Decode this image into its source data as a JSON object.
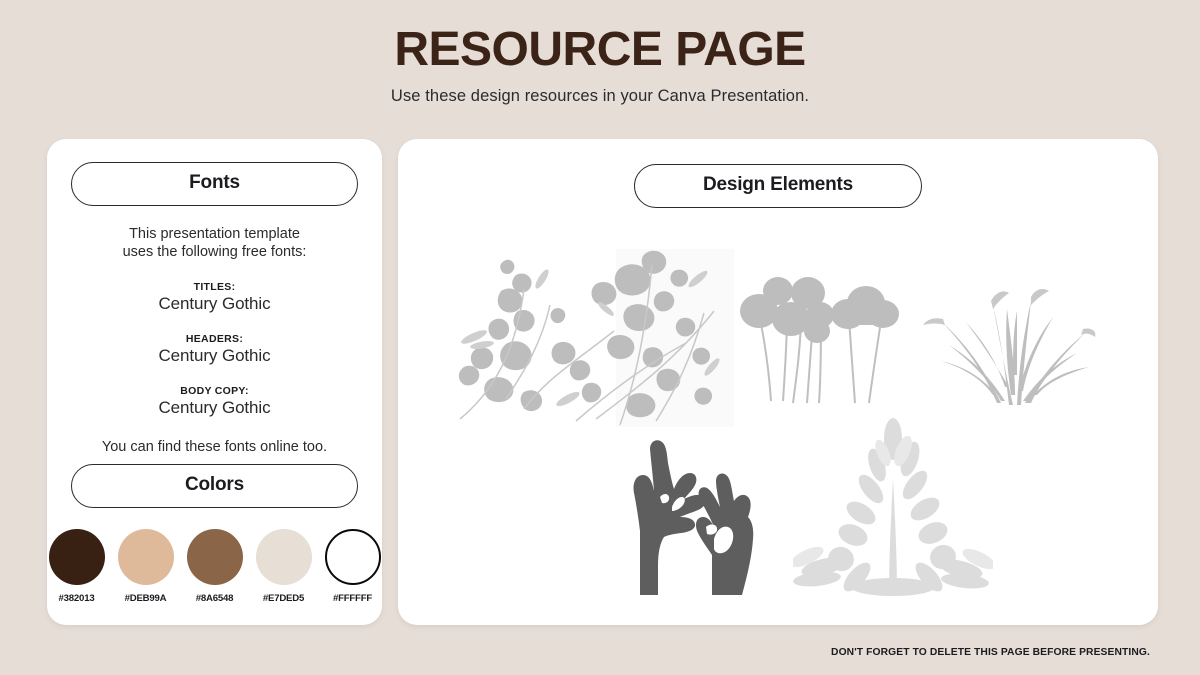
{
  "header": {
    "title": "RESOURCE PAGE",
    "subtitle": "Use these design resources in your Canva Presentation."
  },
  "fonts_panel": {
    "heading": "Fonts",
    "intro_line_1": "This presentation template",
    "intro_line_2": "uses the following free fonts:",
    "groups": [
      {
        "role": "TITLES:",
        "font": "Century Gothic"
      },
      {
        "role": "HEADERS:",
        "font": "Century Gothic"
      },
      {
        "role": "BODY COPY:",
        "font": "Century Gothic"
      }
    ],
    "outro": "You can find these fonts online too."
  },
  "colors_panel": {
    "heading": "Colors",
    "swatches": [
      {
        "hex_label": "#382013",
        "color": "#382013",
        "outlined": false
      },
      {
        "hex_label": "#DEB99A",
        "color": "#DEB99A",
        "outlined": false
      },
      {
        "hex_label": "#8A6548",
        "color": "#8A6548",
        "outlined": false
      },
      {
        "hex_label": "#E7DED5",
        "color": "#E7DED5",
        "outlined": false
      },
      {
        "hex_label": "#FFFFFF",
        "color": "#FFFFFF",
        "outlined": true
      }
    ]
  },
  "elements_panel": {
    "heading": "Design Elements",
    "items": [
      {
        "name": "leaf-branch-shadow-image",
        "description": "grey leafy branch shadow overlay"
      },
      {
        "name": "billy-button-flowers-shadow-image",
        "description": "round headed flower silhouettes"
      },
      {
        "name": "grass-blades-shadow-image",
        "description": "grass blade shadow cluster"
      },
      {
        "name": "hands-silhouette-image",
        "description": "two dark hand silhouettes"
      },
      {
        "name": "olive-branch-shadow-image",
        "description": "soft olive branch shadow"
      }
    ]
  },
  "footer": {
    "note": "DON'T FORGET TO DELETE THIS PAGE BEFORE PRESENTING."
  },
  "theme": {
    "background": "#E6DDD7",
    "title_color": "#3B2317",
    "text_color": "#2B2B2E",
    "card_background": "#FFFFFF",
    "shadow_grey": "#BCBCBC",
    "hands_grey": "#5E5E5E"
  }
}
